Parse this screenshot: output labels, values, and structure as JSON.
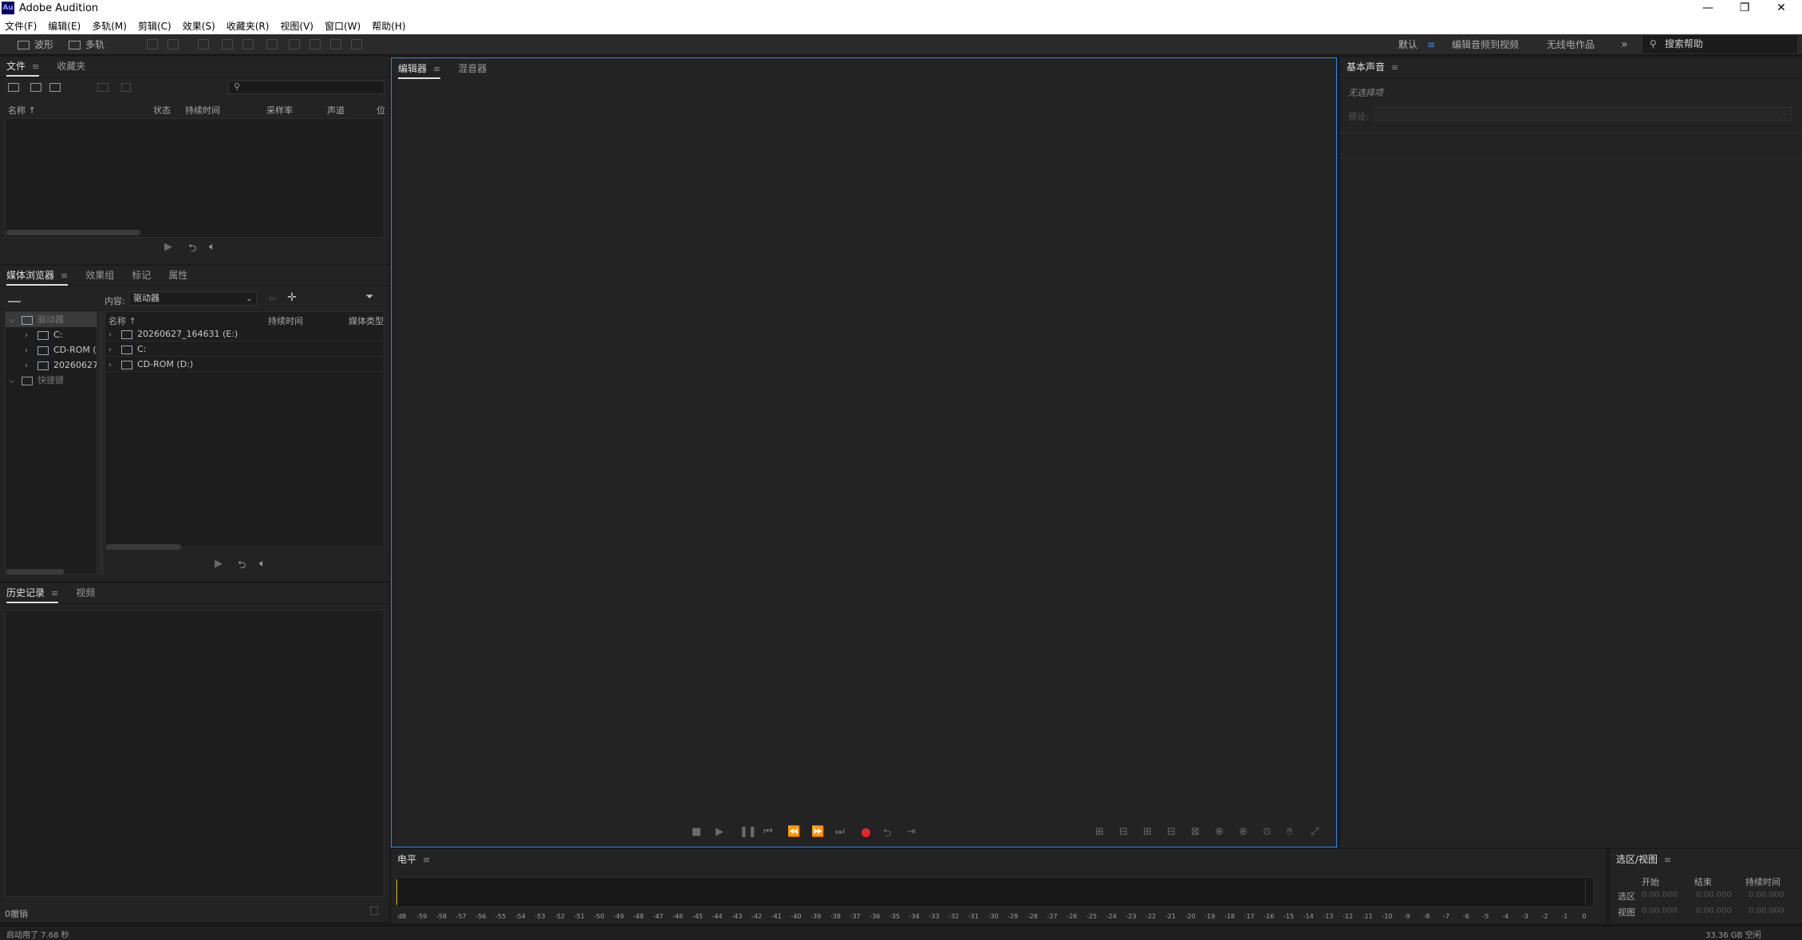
{
  "window": {
    "title": "Adobe Audition",
    "logo": "Au",
    "min": "—",
    "restore": "❐",
    "close": "✕"
  },
  "menu": [
    "文件(F)",
    "编辑(E)",
    "多轨(M)",
    "剪辑(C)",
    "效果(S)",
    "收藏夹(R)",
    "视图(V)",
    "窗口(W)",
    "帮助(H)"
  ],
  "toolbar": {
    "waveform": "波形",
    "multitrack": "多轨",
    "workspace_active": "默认",
    "workspace_menu": "≡",
    "workspace_2": "编辑音频到视频",
    "workspace_3": "无线电作品",
    "more": "»",
    "search_placeholder": "搜索帮助",
    "accent": "#3d8ee6"
  },
  "files_panel": {
    "tabs": [
      "文件",
      "收藏夹"
    ],
    "menu_icon": "≡",
    "search_icon": "⚲",
    "columns": [
      "名称 ↑",
      "状态",
      "持续时间",
      "采样率",
      "声道",
      "位"
    ]
  },
  "media_browser": {
    "tabs": [
      "媒体浏览器",
      "效果组",
      "标记",
      "属性"
    ],
    "menu_icon": "≡",
    "content_label": "内容:",
    "content_value": "驱动器",
    "tree": [
      {
        "label": "驱动器",
        "expanded": true
      },
      {
        "label": "C:"
      },
      {
        "label": "CD-ROM ("
      },
      {
        "label": "20260627"
      },
      {
        "label": "快捷键",
        "expanded": true
      }
    ],
    "columns": [
      "名称 ↑",
      "持续时间",
      "媒体类型"
    ],
    "rows": [
      {
        "name": "20260627_164631 (E:)"
      },
      {
        "name": "C:"
      },
      {
        "name": "CD-ROM (D:)"
      }
    ]
  },
  "history_panel": {
    "tabs": [
      "历史记录",
      "视频"
    ],
    "menu_icon": "≡",
    "undo_count": "0撤销"
  },
  "editor": {
    "tabs": [
      "编辑器",
      "混音器"
    ],
    "menu_icon": "≡",
    "record_color": "#e8262b"
  },
  "essential_sound": {
    "tab": "基本声音",
    "menu_icon": "≡",
    "no_selection": "无选择项",
    "preset_label": "预设:"
  },
  "levels": {
    "tab": "电平",
    "menu_icon": "≡",
    "ruler": [
      "dB",
      "-59",
      "-58",
      "-57",
      "-56",
      "-55",
      "-54",
      "-53",
      "-52",
      "-51",
      "-50",
      "-49",
      "-48",
      "-47",
      "-46",
      "-45",
      "-44",
      "-43",
      "-42",
      "-41",
      "-40",
      "-39",
      "-38",
      "-37",
      "-36",
      "-35",
      "-34",
      "-33",
      "-32",
      "-31",
      "-30",
      "-29",
      "-28",
      "-27",
      "-26",
      "-25",
      "-24",
      "-23",
      "-22",
      "-21",
      "-20",
      "-19",
      "-18",
      "-17",
      "-16",
      "-15",
      "-14",
      "-13",
      "-12",
      "-11",
      "-10",
      "-9",
      "-8",
      "-7",
      "-6",
      "-5",
      "-4",
      "-3",
      "-2",
      "-1",
      "0"
    ]
  },
  "selection_view": {
    "tab": "选区/视图",
    "menu_icon": "≡",
    "headers": [
      "开始",
      "结束",
      "持续时间"
    ],
    "rows": [
      {
        "label": "选区",
        "start": "0:00.000",
        "end": "0:00.000",
        "duration": "0:00.000"
      },
      {
        "label": "视图",
        "start": "0:00.000",
        "end": "0:00.000",
        "duration": "0:00.000"
      }
    ]
  },
  "status": {
    "startup": "启动用了 7.68 秒",
    "disk_free": "33.36 GB 空闲"
  }
}
